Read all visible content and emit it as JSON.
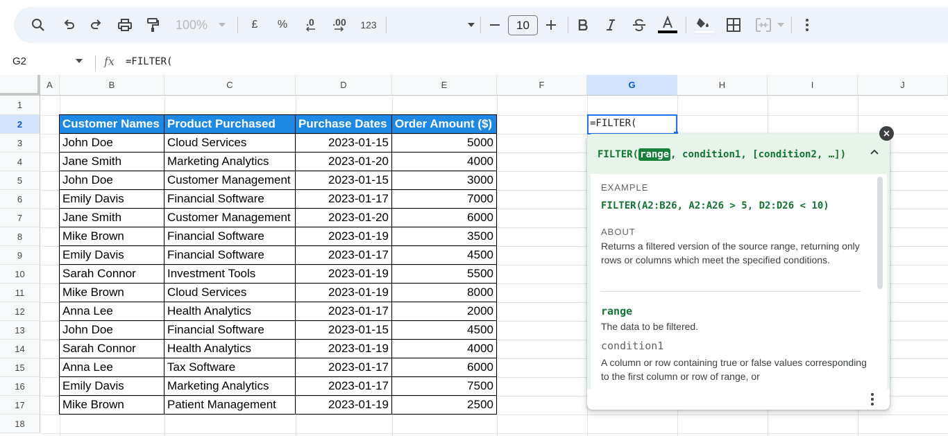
{
  "toolbar": {
    "zoom": "100%",
    "currency_symbol": "£",
    "percent_symbol": "%",
    "decrease_decimal": ".0",
    "increase_decimal": ".00",
    "number_format": "123",
    "font_size": "10",
    "text_color": "#000000"
  },
  "formula_bar": {
    "name_box": "G2",
    "fx": "fx",
    "formula": "=FILTER("
  },
  "columns": [
    "A",
    "B",
    "C",
    "D",
    "E",
    "F",
    "G",
    "H",
    "I",
    "J"
  ],
  "rows": [
    "1",
    "2",
    "3",
    "4",
    "5",
    "6",
    "7",
    "8",
    "9",
    "10",
    "11",
    "12",
    "13",
    "14",
    "15",
    "16",
    "17",
    "18"
  ],
  "selected_column": "G",
  "selected_row": "2",
  "table": {
    "headers": [
      "Customer Names",
      "Product Purchased",
      "Purchase Dates",
      "Order Amount ($)"
    ],
    "rows": [
      [
        "John Doe",
        "Cloud Services",
        "2023-01-15",
        "5000"
      ],
      [
        "Jane Smith",
        "Marketing Analytics",
        "2023-01-20",
        "4000"
      ],
      [
        "John Doe",
        "Customer Management",
        "2023-01-15",
        "3000"
      ],
      [
        "Emily Davis",
        "Financial Software",
        "2023-01-17",
        "7000"
      ],
      [
        "Jane Smith",
        "Customer Management",
        "2023-01-20",
        "6000"
      ],
      [
        "Mike Brown",
        "Financial Software",
        "2023-01-19",
        "3500"
      ],
      [
        "Emily Davis",
        "Financial Software",
        "2023-01-17",
        "4500"
      ],
      [
        "Sarah Connor",
        "Investment Tools",
        "2023-01-19",
        "5500"
      ],
      [
        "Mike Brown",
        "Cloud Services",
        "2023-01-19",
        "8000"
      ],
      [
        "Anna Lee",
        "Health Analytics",
        "2023-01-17",
        "2000"
      ],
      [
        "John Doe",
        "Financial Software",
        "2023-01-15",
        "4500"
      ],
      [
        "Sarah Connor",
        "Health Analytics",
        "2023-01-19",
        "4000"
      ],
      [
        "Anna Lee",
        "Tax Software",
        "2023-01-17",
        "6000"
      ],
      [
        "Emily Davis",
        "Marketing Analytics",
        "2023-01-17",
        "7500"
      ],
      [
        "Mike Brown",
        "Patient Management",
        "2023-01-19",
        "2500"
      ]
    ],
    "header_color": "#1e88e5"
  },
  "active_cell": {
    "ref": "G2",
    "content": "=FILTER("
  },
  "help": {
    "signature_prefix": "FILTER(",
    "signature_highlight": "range",
    "signature_rest": ", condition1, [condition2, …])",
    "example_title": "EXAMPLE",
    "example": "FILTER(A2:B26, A2:A26 > 5, D2:D26 < 10)",
    "about_title": "ABOUT",
    "about": "Returns a filtered version of the source range, returning only rows or columns which meet the specified conditions.",
    "arg1_name": "range",
    "arg1_desc": "The data to be filtered.",
    "arg2_name": "condition1",
    "arg2_desc": "A column or row containing true or false values corresponding to the first column or row of range, or"
  }
}
